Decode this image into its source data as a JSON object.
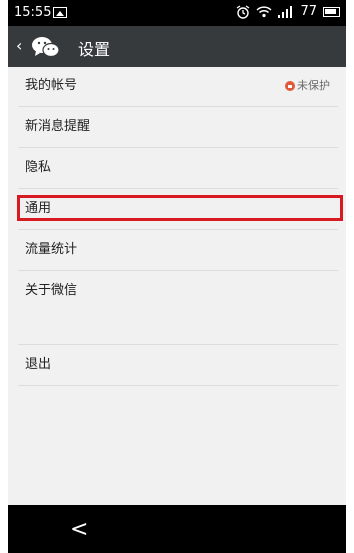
{
  "status_bar": {
    "time": "15:55",
    "battery": "77"
  },
  "title_bar": {
    "back_icon": "‹",
    "title": "设置"
  },
  "settings_items": [
    {
      "label": "我的帐号",
      "badge": "未保护"
    },
    {
      "label": "新消息提醒"
    },
    {
      "label": "隐私"
    },
    {
      "label": "通用"
    },
    {
      "label": "流量统计"
    },
    {
      "label": "关于微信"
    }
  ],
  "logout_label": "退出",
  "nav": {
    "back_icon": "<"
  },
  "colors": {
    "titlebar": "#363a3d",
    "highlight": "#d81b21",
    "badge": "#e2583b"
  }
}
